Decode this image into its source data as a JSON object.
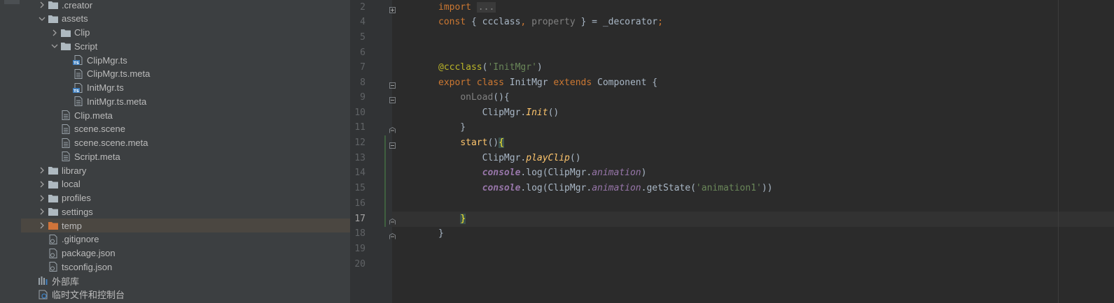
{
  "tree": {
    "items": [
      {
        "label": ".creator",
        "kind": "folder",
        "indent": 1,
        "expanded": false,
        "y": 0
      },
      {
        "label": "assets",
        "kind": "folder",
        "indent": 1,
        "expanded": true,
        "y": 1
      },
      {
        "label": "Clip",
        "kind": "folder",
        "indent": 2,
        "expanded": false,
        "y": 2
      },
      {
        "label": "Script",
        "kind": "folder",
        "indent": 2,
        "expanded": true,
        "y": 3
      },
      {
        "label": "ClipMgr.ts",
        "kind": "ts",
        "indent": 3,
        "y": 4
      },
      {
        "label": "ClipMgr.ts.meta",
        "kind": "file",
        "indent": 3,
        "y": 5
      },
      {
        "label": "InitMgr.ts",
        "kind": "ts",
        "indent": 3,
        "y": 6
      },
      {
        "label": "InitMgr.ts.meta",
        "kind": "file",
        "indent": 3,
        "y": 7
      },
      {
        "label": "Clip.meta",
        "kind": "file",
        "indent": 2,
        "y": 8
      },
      {
        "label": "scene.scene",
        "kind": "file",
        "indent": 2,
        "y": 9
      },
      {
        "label": "scene.scene.meta",
        "kind": "file",
        "indent": 2,
        "y": 10
      },
      {
        "label": "Script.meta",
        "kind": "file",
        "indent": 2,
        "y": 11
      },
      {
        "label": "library",
        "kind": "folder",
        "indent": 1,
        "expanded": false,
        "y": 12
      },
      {
        "label": "local",
        "kind": "folder",
        "indent": 1,
        "expanded": false,
        "y": 13
      },
      {
        "label": "profiles",
        "kind": "folder",
        "indent": 1,
        "expanded": false,
        "y": 14
      },
      {
        "label": "settings",
        "kind": "folder",
        "indent": 1,
        "expanded": false,
        "y": 15
      },
      {
        "label": "temp",
        "kind": "folder-orange",
        "indent": 1,
        "expanded": false,
        "y": 16,
        "selected": true
      },
      {
        "label": ".gitignore",
        "kind": "config",
        "indent": 1,
        "y": 17
      },
      {
        "label": "package.json",
        "kind": "config",
        "indent": 1,
        "y": 18
      },
      {
        "label": "tsconfig.json",
        "kind": "config",
        "indent": 1,
        "y": 19
      },
      {
        "label": "外部库",
        "kind": "library",
        "indent": 0,
        "y": 20
      },
      {
        "label": "临时文件和控制台",
        "kind": "scratch",
        "indent": 0,
        "y": 21
      }
    ]
  },
  "editor": {
    "current_line": "17",
    "lines": [
      {
        "no": "2",
        "fold": "plus"
      },
      {
        "no": "4"
      },
      {
        "no": "5"
      },
      {
        "no": "6"
      },
      {
        "no": "7"
      },
      {
        "no": "8",
        "fold": "minus"
      },
      {
        "no": "9",
        "fold": "minus"
      },
      {
        "no": "10"
      },
      {
        "no": "11",
        "fold": "end"
      },
      {
        "no": "12",
        "fold": "minus"
      },
      {
        "no": "13"
      },
      {
        "no": "14"
      },
      {
        "no": "15"
      },
      {
        "no": "16"
      },
      {
        "no": "17",
        "fold": "end"
      },
      {
        "no": "18",
        "fold": "end"
      },
      {
        "no": "19"
      },
      {
        "no": "20"
      }
    ],
    "code": {
      "l2_kw": "import",
      "l2_folded": "...",
      "l4_kw": "const",
      "l4_open": " { ",
      "l4_ccclass": "ccclass",
      "l4_comma": ",",
      "l4_property": " property",
      "l4_close": " } = _decorator",
      "l4_semi": ";",
      "l7_dec": "@ccclass",
      "l7_paren_open": "(",
      "l7_str": "'InitMgr'",
      "l7_paren_close": ")",
      "l8_export": "export",
      "l8_class": " class",
      "l8_name": " InitMgr",
      "l8_extends": " extends",
      "l8_base": " Component {",
      "l9_indent": "    ",
      "l9_fn": "onLoad",
      "l9_rest": "(){",
      "l10_indent": "        ",
      "l10_obj": "ClipMgr.",
      "l10_fn": "Init",
      "l10_rest": "()",
      "l11_text": "    }",
      "l12_indent": "    ",
      "l12_fn": "start",
      "l12_parens": "()",
      "l12_brace": "{",
      "l13_indent": "        ",
      "l13_obj": "ClipMgr.",
      "l13_fn": "playClip",
      "l13_rest": "()",
      "l14_indent": "        ",
      "l14_console": "console",
      "l14_dot": ".",
      "l14_log": "log",
      "l14_open": "(ClipMgr.",
      "l14_prop": "animation",
      "l14_close": ")",
      "l15_indent": "        ",
      "l15_console": "console",
      "l15_dot": ".",
      "l15_log": "log",
      "l15_open": "(ClipMgr.",
      "l15_prop": "animation",
      "l15_mid": ".getState(",
      "l15_str": "'animation1'",
      "l15_close": "))",
      "l17_indent": "    ",
      "l17_brace": "}",
      "l18_text": "}"
    }
  },
  "colors": {
    "panel": "#3c3f41",
    "editor": "#2b2b2b",
    "keyword": "#cc7832",
    "function": "#ffc66d",
    "string": "#6a8759",
    "property": "#9876aa",
    "folder": "#aeb9c0",
    "folder_orange": "#d0743a"
  }
}
